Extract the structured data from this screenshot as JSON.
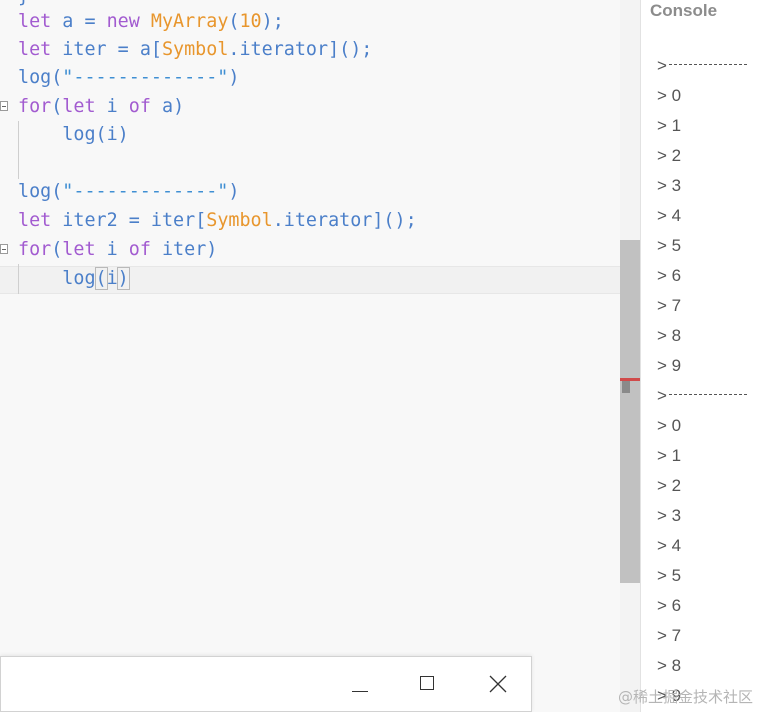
{
  "editor": {
    "top_fragment": "}",
    "lines": {
      "l1": {
        "kw1": "let",
        "sp1": " ",
        "var": "a",
        "eq": " = ",
        "kw2": "new",
        "sp2": " ",
        "cls": "MyArray",
        "p1": "(",
        "num": "10",
        "p2": ");"
      },
      "l2": {
        "kw1": "let",
        "sp1": " ",
        "var": "iter",
        "eq": " = ",
        "obj": "a",
        "b1": "[",
        "cls": "Symbol",
        "dot": ".iterator",
        "b2": "]();"
      },
      "l3": {
        "fn": "log",
        "p1": "(",
        "str": "\"-------------\"",
        "p2": ")"
      },
      "l4": {
        "kw1": "for",
        "p1": "(",
        "kw2": "let",
        "sp1": " ",
        "var": "i",
        "sp2": " ",
        "kw3": "of",
        "sp3": " ",
        "obj": "a",
        "p2": ")"
      },
      "l5": {
        "indent": "    ",
        "fn": "log",
        "p1": "(",
        "var": "i",
        "p2": ")"
      },
      "l7": {
        "fn": "log",
        "p1": "(",
        "str": "\"-------------\"",
        "p2": ")"
      },
      "l8": {
        "kw1": "let",
        "sp1": " ",
        "var": "iter2",
        "eq": " = ",
        "obj": "iter",
        "b1": "[",
        "cls": "Symbol",
        "dot": ".iterator",
        "b2": "]();"
      },
      "l9": {
        "kw1": "for",
        "p1": "(",
        "kw2": "let",
        "sp1": " ",
        "var": "i",
        "sp2": " ",
        "kw3": "of",
        "sp3": " ",
        "obj": "iter",
        "p2": ")"
      },
      "l10": {
        "indent": "    ",
        "fn": "log",
        "p1": "(",
        "var": "i",
        "p2": ")"
      }
    }
  },
  "console": {
    "title": "Console",
    "prompt": ">",
    "entries": [
      "0",
      "1",
      "2",
      "3",
      "4",
      "5",
      "6",
      "7",
      "8",
      "9",
      "0",
      "1",
      "2",
      "3",
      "4",
      "5",
      "6",
      "7",
      "8",
      "9"
    ]
  },
  "watermark": "@稀土掘金技术社区",
  "colors": {
    "keyword": "#a25bd0",
    "class_name": "#e8962d",
    "number": "#e8962d",
    "identifier": "#4b7fc9",
    "string": "#3f8fd3"
  },
  "icons": [
    "fold-toggle-icon",
    "minimize-icon",
    "maximize-icon",
    "close-icon"
  ]
}
